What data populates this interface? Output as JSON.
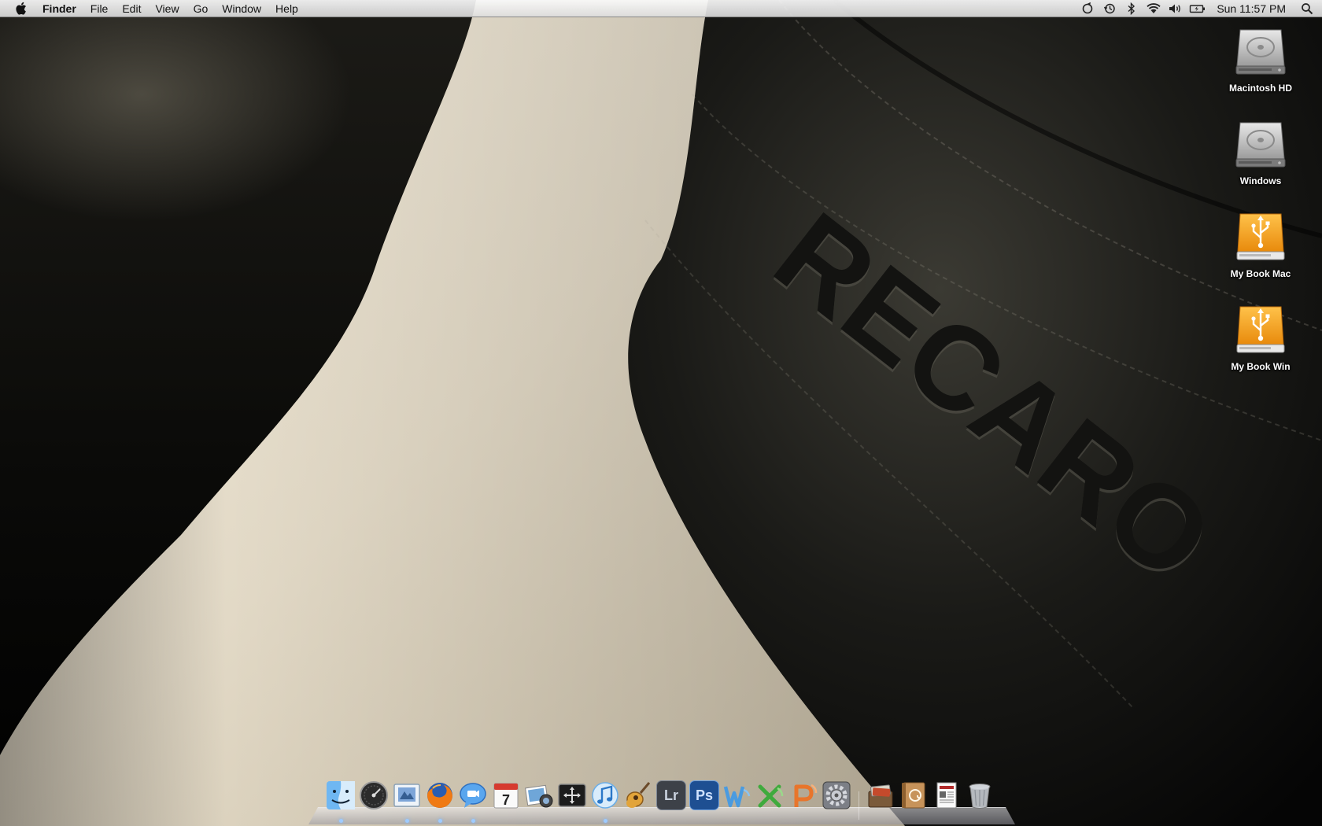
{
  "menubar": {
    "apple_icon": "apple-icon",
    "items": [
      "Finder",
      "File",
      "Edit",
      "View",
      "Go",
      "Window",
      "Help"
    ],
    "status_icons": [
      "sync-icon",
      "time-machine-icon",
      "bluetooth-icon",
      "wifi-icon",
      "volume-icon",
      "battery-icon"
    ],
    "clock": "Sun 11:57 PM",
    "spotlight_icon": "spotlight-search-icon"
  },
  "wallpaper": {
    "embossed_text": "RECARO"
  },
  "desktop_icons": [
    {
      "label": "Macintosh HD",
      "icon": "hard-drive-icon"
    },
    {
      "label": "Windows",
      "icon": "hard-drive-icon"
    },
    {
      "label": "My Book Mac",
      "icon": "usb-drive-icon"
    },
    {
      "label": "My Book Win",
      "icon": "usb-drive-icon"
    }
  ],
  "dock": {
    "apps": [
      {
        "icon": "finder-icon",
        "running": true
      },
      {
        "icon": "dashboard-icon",
        "running": false
      },
      {
        "icon": "mail-icon",
        "running": true
      },
      {
        "icon": "firefox-icon",
        "running": true
      },
      {
        "icon": "ichat-icon",
        "running": true
      },
      {
        "icon": "ical-icon",
        "running": false,
        "date": "7"
      },
      {
        "icon": "iphoto-icon",
        "running": false
      },
      {
        "icon": "spaces-icon",
        "running": false
      },
      {
        "icon": "itunes-icon",
        "running": true
      },
      {
        "icon": "garageband-icon",
        "running": false
      },
      {
        "icon": "lightroom-icon",
        "running": false,
        "text": "Lr"
      },
      {
        "icon": "photoshop-icon",
        "running": false,
        "text": "Ps"
      },
      {
        "icon": "word-icon",
        "running": false
      },
      {
        "icon": "excel-icon",
        "running": false
      },
      {
        "icon": "powerpoint-icon",
        "running": false
      },
      {
        "icon": "system-preferences-icon",
        "running": false
      }
    ],
    "docs": [
      {
        "icon": "applications-stack-icon"
      },
      {
        "icon": "address-book-icon"
      },
      {
        "icon": "documents-stack-icon"
      },
      {
        "icon": "trash-icon"
      }
    ]
  },
  "colors": {
    "menubar": "#e8e8e8",
    "usb_drive": "#f5a21b",
    "hard_drive": "#c8c8c8",
    "dock_running_indicator": "#9ecbff"
  }
}
